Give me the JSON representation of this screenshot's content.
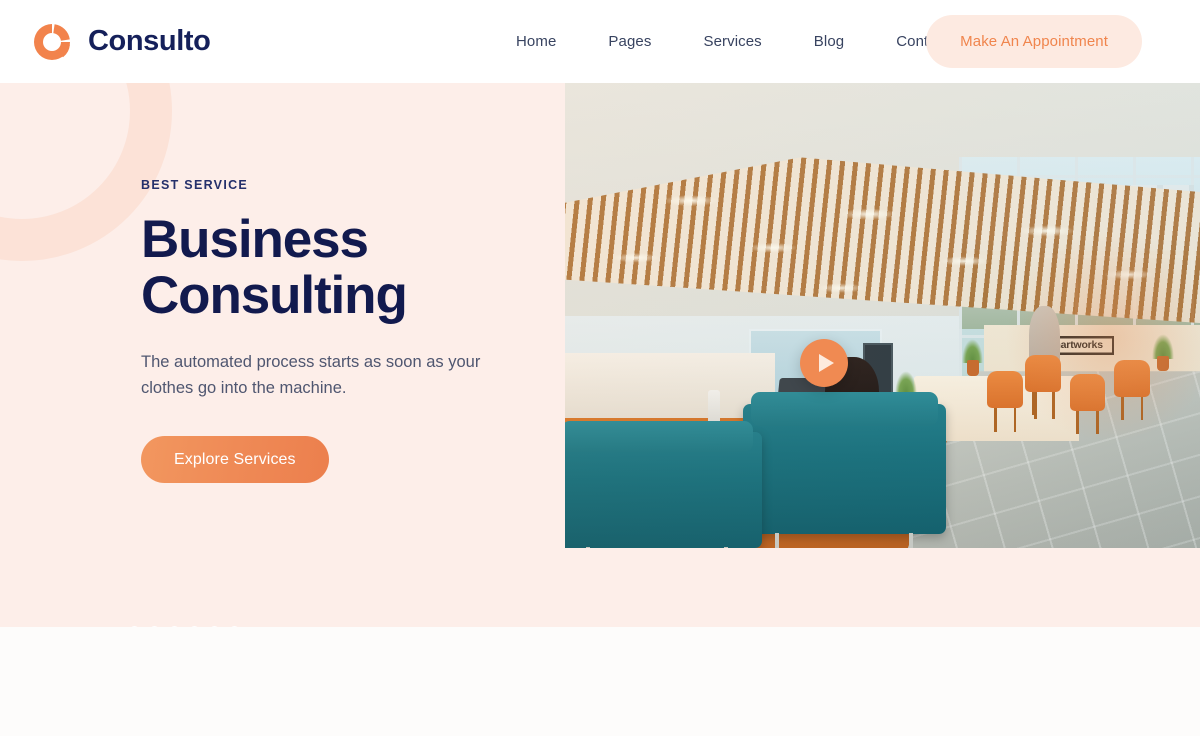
{
  "brand": {
    "name": "Consulto",
    "logo_icon": "donut-chart-logo-icon",
    "logo_color": "#f2834c",
    "name_color": "#15205a"
  },
  "header": {
    "nav_items": [
      {
        "label": "Home"
      },
      {
        "label": "Pages"
      },
      {
        "label": "Services"
      },
      {
        "label": "Blog"
      },
      {
        "label": "Contact"
      }
    ],
    "appointment_button": {
      "label": "Make An Appointment",
      "text_color": "#f0854d",
      "background_color": "#fdeae1"
    }
  },
  "hero": {
    "eyebrow": "BEST SERVICE",
    "title_line1": "Business",
    "title_line2": "Consulting",
    "subtitle": "The automated process starts as soon as your clothes go into the machine.",
    "cta_label": "Explore Services",
    "background_color": "#fdeee9",
    "title_color": "#121a4e",
    "accent_color": "#ef8a56",
    "decor": {
      "ring_color": "#fbdfd4",
      "dot_color": "#ffffff",
      "dot_columns": 6,
      "dot_rows": 5
    },
    "media": {
      "alt": "Modern open-plan office lobby with wooden slatted ceiling, teal sofas, orange chairs and floor-to-ceiling windows",
      "sign_text": "smartworks",
      "play_button_icon": "play-icon",
      "play_button_color": "#f08a52"
    }
  }
}
